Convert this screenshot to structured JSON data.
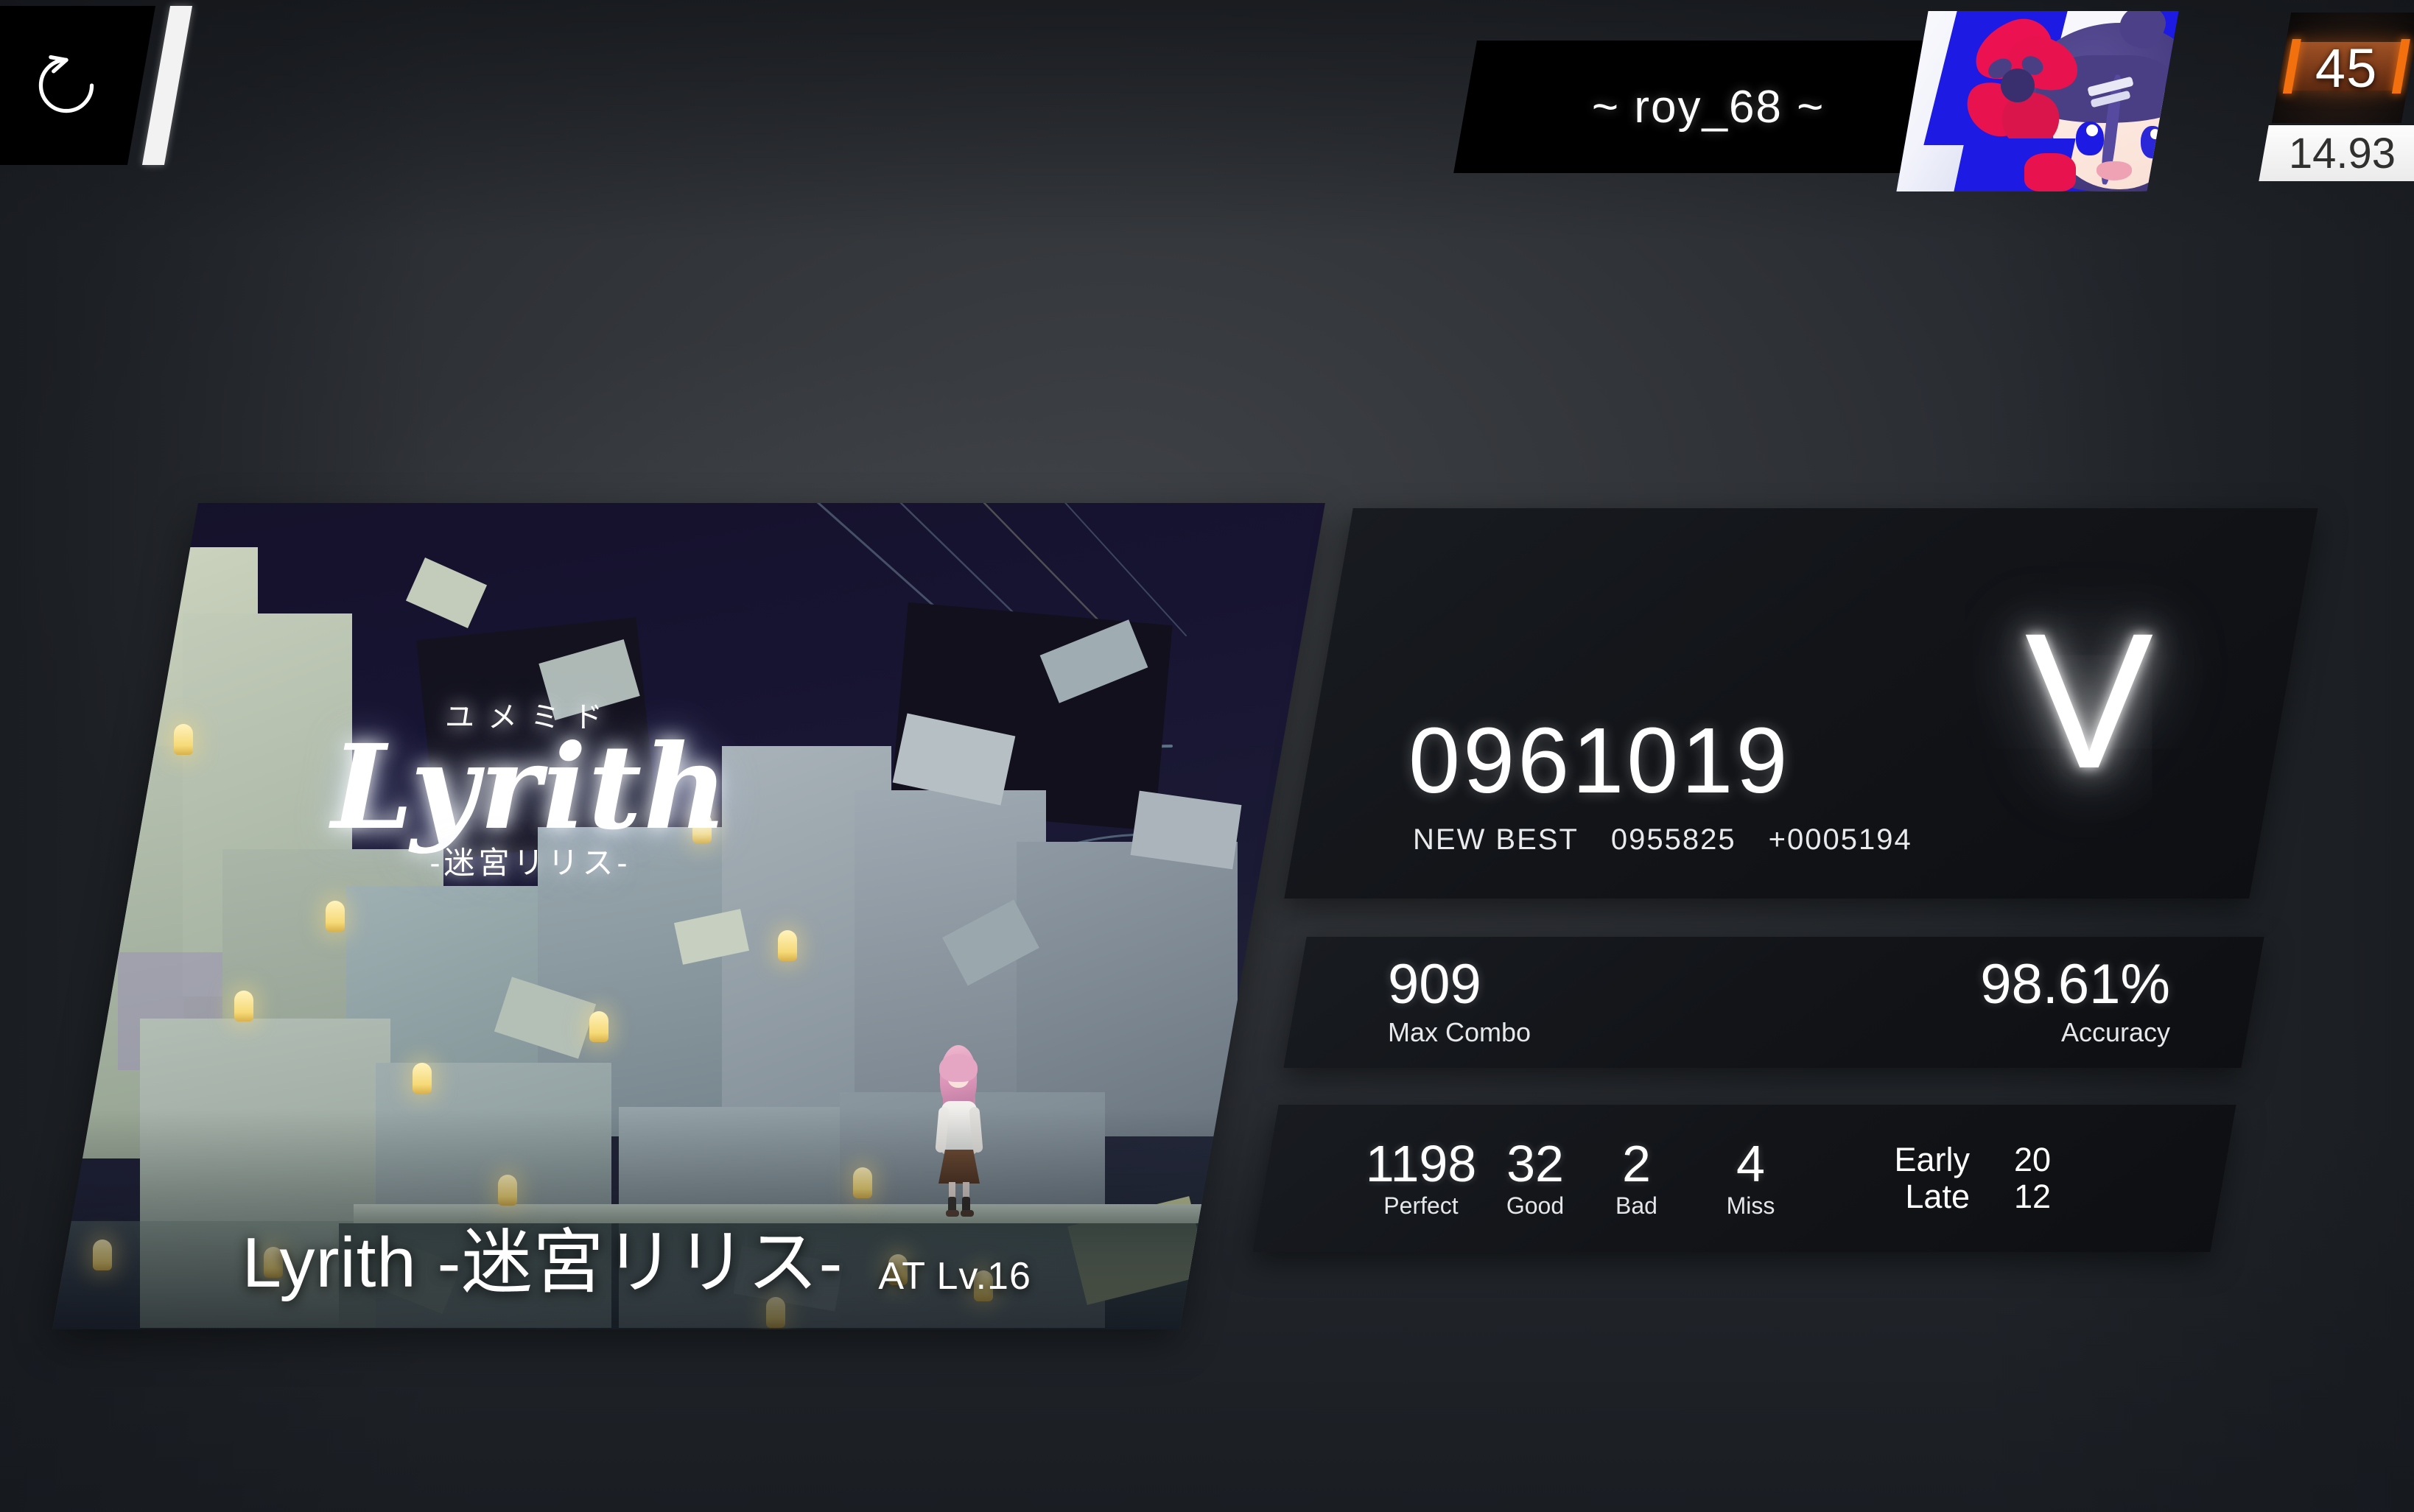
{
  "header": {
    "retry_icon": "retry-circular-arrow-icon",
    "slash_divider": "diagonal-slash-bar"
  },
  "player": {
    "name": "~ roy_68 ~",
    "level": "45",
    "potential": "14.93",
    "avatar_alt": "anime-girl-with-butterfly-hairpin"
  },
  "song": {
    "title": "Lyrith -迷宮リリス-",
    "difficulty": "AT  Lv.16",
    "jacket_furigana": "ユメミド",
    "jacket_logo": "Lyrith",
    "jacket_subtitle": "-迷宮リリス-"
  },
  "result": {
    "score": "0961019",
    "new_best_label": "NEW BEST",
    "previous_best": "0955825",
    "score_delta": "+0005194",
    "grade": "V",
    "max_combo": "909",
    "max_combo_label": "Max Combo",
    "accuracy": "98.61%",
    "accuracy_label": "Accuracy"
  },
  "judgments": [
    {
      "count": "1198",
      "label": "Perfect"
    },
    {
      "count": "32",
      "label": "Good"
    },
    {
      "count": "2",
      "label": "Bad"
    },
    {
      "count": "4",
      "label": "Miss"
    }
  ],
  "timing": {
    "early_label": "Early",
    "late_label": "Late",
    "early_count": "20",
    "late_count": "12"
  },
  "colors": {
    "background": "#303236",
    "panel": "#14171c",
    "level_accent": "#f2700d",
    "potential_bg": "#fdfdfd",
    "text": "#ffffff"
  }
}
